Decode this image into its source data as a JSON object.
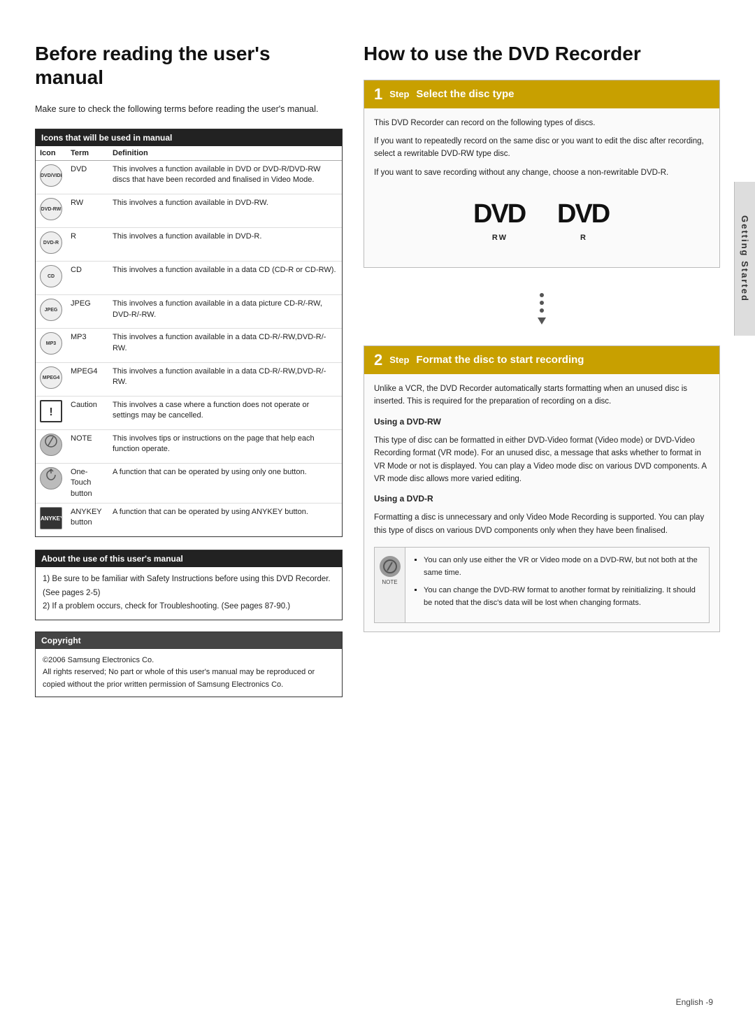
{
  "left": {
    "title": "Before reading the user's manual",
    "intro": "Make sure to check the following terms before reading the user's manual.",
    "icons_table": {
      "header": "Icons that will be used in manual",
      "columns": [
        "Icon",
        "Term",
        "Definition"
      ],
      "rows": [
        {
          "icon_type": "dvd-video",
          "icon_label": "DVD/VIDEO",
          "term": "DVD",
          "definition": "This involves a function available in DVD or DVD-R/DVD-RW discs that have been recorded and finalised in Video Mode."
        },
        {
          "icon_type": "dvd-rw",
          "icon_label": "DVD-RW",
          "term": "RW",
          "definition": "This involves a function available in DVD-RW."
        },
        {
          "icon_type": "dvd-r",
          "icon_label": "DVD-R",
          "term": "R",
          "definition": "This involves a function available in DVD-R."
        },
        {
          "icon_type": "cd",
          "icon_label": "CD",
          "term": "CD",
          "definition": "This involves a function available in a data CD (CD-R or CD-RW)."
        },
        {
          "icon_type": "jpeg",
          "icon_label": "JPEG",
          "term": "JPEG",
          "definition": "This involves a function available in a data picture CD-R/-RW, DVD-R/-RW."
        },
        {
          "icon_type": "mp3",
          "icon_label": "MP3",
          "term": "MP3",
          "definition": "This involves a function available in a data CD-R/-RW,DVD-R/-RW."
        },
        {
          "icon_type": "mpeg4",
          "icon_label": "MPEG4",
          "term": "MPEG4",
          "definition": "This involves a function available in a data CD-R/-RW,DVD-R/-RW."
        },
        {
          "icon_type": "caution",
          "icon_label": "!",
          "term": "Caution",
          "definition": "This involves a case where a function does not operate or settings may be cancelled."
        },
        {
          "icon_type": "note",
          "icon_label": "NOTE",
          "term": "NOTE",
          "definition": "This involves tips or instructions on the page that help each function operate."
        },
        {
          "icon_type": "onetouch",
          "icon_label": "OT",
          "term": "One-Touch button",
          "definition": "A function that can be operated by using only one button."
        },
        {
          "icon_type": "anykey",
          "icon_label": "ANYKEY",
          "term": "ANYKEY button",
          "definition": "A function that can be operated by using ANYKEY button."
        }
      ]
    },
    "about": {
      "header": "About the use of this user's manual",
      "items": [
        "1) Be sure to be familiar with Safety Instructions before using this DVD Recorder. (See pages 2-5)",
        "2) If a problem occurs, check for Troubleshooting. (See pages 87-90.)"
      ]
    },
    "copyright": {
      "header": "Copyright",
      "text": "©2006 Samsung Electronics Co.\nAll rights reserved; No part or whole of this user's manual may be reproduced or copied without the prior written permission of Samsung Electronics Co."
    }
  },
  "right": {
    "title": "How to use the DVD Recorder",
    "step1": {
      "num": "1",
      "title": "Select the disc type",
      "content_p1": "This DVD Recorder can record on the following types of discs.",
      "content_p2": "If you want to repeatedly record on the same disc or you want to edit the disc after recording, select a rewritable DVD-RW type disc.",
      "content_p3": "If you want to save recording without any change, choose a non-rewritable DVD-R.",
      "dvd_rw_label": "RW",
      "dvd_r_label": "R"
    },
    "step2": {
      "num": "2",
      "title": "Format the disc to start recording",
      "content_intro": "Unlike a VCR, the DVD Recorder automatically starts formatting when an unused disc is inserted. This is required for the preparation of recording on a disc.",
      "using_rw_head": "Using a DVD-RW",
      "using_rw_text": "This type of disc can be formatted in either DVD-Video format (Video mode) or DVD-Video Recording format (VR mode). For an unused disc, a message that asks whether to format in VR Mode or not is displayed. You can play a Video mode disc on various DVD components. A VR mode disc allows more varied editing.",
      "using_r_head": "Using a DVD-R",
      "using_r_text": "Formatting a disc is unnecessary and only Video Mode Recording is supported. You can play this type of discs on various DVD components only when they have been finalised.",
      "note_bullets": [
        "You can only use either the VR or Video mode on a DVD-RW, but not both at the same time.",
        "You can change the DVD-RW format to another format by reinitializing. It should be noted that the disc's data will be lost when changing formats."
      ]
    },
    "side_tab": "Getting Started"
  },
  "footer": {
    "text": "English -9"
  }
}
